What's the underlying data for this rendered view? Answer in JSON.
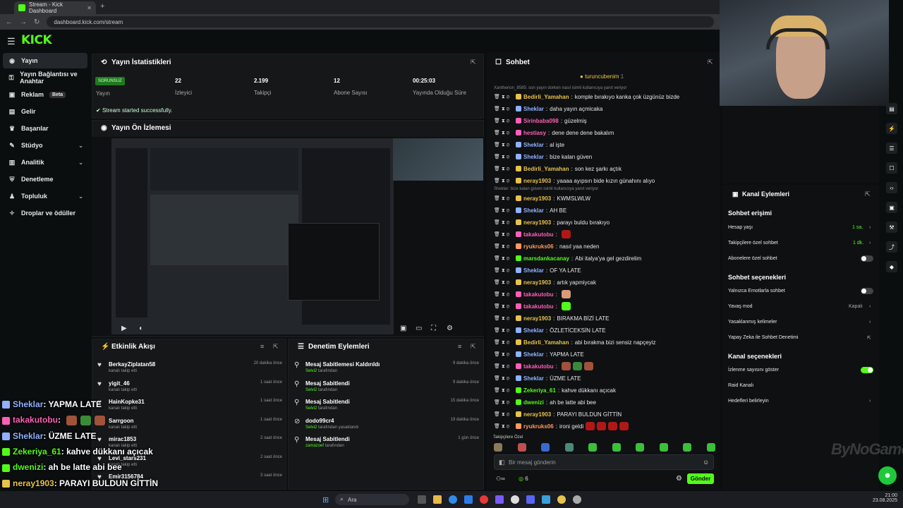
{
  "browser": {
    "tab_title": "Stream - Kick Dashboard",
    "url": "dashboard.kick.com/stream"
  },
  "brand": {
    "logo": "KICK",
    "accent": "#53fc18"
  },
  "sidebar": {
    "items": [
      {
        "label": "Yayın",
        "icon": "broadcast-icon"
      },
      {
        "label": "Yayın Bağlantısı ve Anahtar",
        "icon": "key-icon"
      },
      {
        "label": "Reklam",
        "icon": "ad-icon",
        "badge": "Beta"
      },
      {
        "label": "Gelir",
        "icon": "wallet-icon"
      },
      {
        "label": "Başarılar",
        "icon": "trophy-icon"
      },
      {
        "label": "Stüdyo",
        "icon": "studio-icon"
      },
      {
        "label": "Analitik",
        "icon": "chart-icon"
      },
      {
        "label": "Denetleme",
        "icon": "shield-icon"
      },
      {
        "label": "Topluluk",
        "icon": "people-icon"
      },
      {
        "label": "Droplar ve ödüller",
        "icon": "gift-icon"
      }
    ]
  },
  "stats": {
    "title": "Yayın İstatistikleri",
    "status_badge": "SORUNSUZ",
    "items": [
      {
        "value": "",
        "label": "Yayın"
      },
      {
        "value": "22",
        "label": "İzleyici"
      },
      {
        "value": "2.199",
        "label": "Takipçi"
      },
      {
        "value": "12",
        "label": "Abone Sayısı"
      },
      {
        "value": "00:25:03",
        "label": "Yayında Olduğu Süre"
      }
    ],
    "success_msg": "Stream started successfully."
  },
  "preview": {
    "title": "Yayın Ön İzlemesi"
  },
  "activity": {
    "title": "Etkinlik Akışı",
    "rows": [
      {
        "name": "BerkayZiplatan58",
        "sub": "kanalı takip etti",
        "time": "20 dakika önce"
      },
      {
        "name": "yigit_46",
        "sub": "kanalı takip etti",
        "time": "1 saat önce"
      },
      {
        "name": "HainKopke31",
        "sub": "kanalı takip etti",
        "time": "1 saat önce"
      },
      {
        "name": "Sarrgoon",
        "sub": "kanalı takip etti",
        "time": "1 saat önce"
      },
      {
        "name": "mirac1853",
        "sub": "kanalı takip etti",
        "time": "2 saat önce"
      },
      {
        "name": "Levi_stars231",
        "sub": "kanalı takip etti",
        "time": "2 saat önce"
      },
      {
        "name": "Emir3156784",
        "sub": "",
        "time": "3 saat önce"
      }
    ]
  },
  "moderation": {
    "title": "Denetim Eylemleri",
    "rows": [
      {
        "name": "Mesaj Sabitlemesi Kaldırıldı",
        "who": "Selvi2",
        "rest": " tarafından",
        "time": "9 dakika önce"
      },
      {
        "name": "Mesaj Sabitlendi",
        "who": "Selvi2",
        "rest": " tarafından",
        "time": "9 dakika önce"
      },
      {
        "name": "Mesaj Sabitlendi",
        "who": "Selvi2",
        "rest": " tarafından",
        "time": "15 dakika önce"
      },
      {
        "name": "dodo99cr4",
        "who": "Selvi2",
        "rest": " tarafından yasaklandı",
        "time": "19 dakika önce"
      },
      {
        "name": "Mesaj Sabitlendi",
        "who": "zamazoef",
        "rest": " tarafından",
        "time": "1 gün önce"
      }
    ]
  },
  "chat": {
    "title": "Sohbet",
    "pinned": "turuncubenim",
    "pinned_count": "1",
    "reply1": "Xantherion_8585: son yayın dorken nasıl isimli kullanıcıya yanıt veriyor",
    "reply2": "Sheklar: bize kalan güven isimli kullanıcıya yanıt veriyor",
    "messages": [
      {
        "user": "Bedirli_Yamahan",
        "color": "#e8c24a",
        "text": "komple bırakıyo kanka çok üzgünüz bizde"
      },
      {
        "user": "Sheklar",
        "color": "#8fb1ff",
        "text": "daha yayın açmicaka"
      },
      {
        "user": "Sirinbaba098",
        "color": "#ff5fb8",
        "text": "güzelmiş"
      },
      {
        "user": "hestiasy",
        "color": "#ff5fb8",
        "text": "dene dene dene bakalım"
      },
      {
        "user": "Sheklar",
        "color": "#8fb1ff",
        "text": "al işte"
      },
      {
        "user": "Sheklar",
        "color": "#8fb1ff",
        "text": "bize kalan güven"
      },
      {
        "user": "Bedirli_Yamahan",
        "color": "#e8c24a",
        "text": "son kez şarkı açtık"
      },
      {
        "user": "neray1903",
        "color": "#e8c24a",
        "text": "yaaaa ayıpsın bide kızın günahını alıyo"
      },
      {
        "user": "neray1903",
        "color": "#e8c24a",
        "text": "KWMSLWLW"
      },
      {
        "user": "Sheklar",
        "color": "#8fb1ff",
        "text": "AH BE"
      },
      {
        "user": "neray1903",
        "color": "#e8c24a",
        "text": "parayı buldu bırakıyo"
      },
      {
        "user": "takakutobu",
        "color": "#ff5fb8",
        "text": ""
      },
      {
        "user": "ryukruks06",
        "color": "#ff9a5f",
        "text": "nasıl yaa neden"
      },
      {
        "user": "marsdankacanay",
        "color": "#53fc18",
        "text": "Abi italya'ya gel gezdirelim"
      },
      {
        "user": "Sheklar",
        "color": "#8fb1ff",
        "text": "OF YA LATE"
      },
      {
        "user": "neray1903",
        "color": "#e8c24a",
        "text": "artık yapmiycak"
      },
      {
        "user": "takakutobu",
        "color": "#ff5fb8",
        "text": ""
      },
      {
        "user": "takakutobu",
        "color": "#ff5fb8",
        "text": ""
      },
      {
        "user": "neray1903",
        "color": "#e8c24a",
        "text": "BIRAKMA BİZİ LATE"
      },
      {
        "user": "Sheklar",
        "color": "#8fb1ff",
        "text": "ÖZLETİCEKSİN LATE"
      },
      {
        "user": "Bedirli_Yamahan",
        "color": "#e8c24a",
        "text": "abi bırakma bizi sensiz napçeyiz"
      },
      {
        "user": "Sheklar",
        "color": "#8fb1ff",
        "text": "YAPMA LATE"
      },
      {
        "user": "takakutobu",
        "color": "#ff5fb8",
        "text": ""
      },
      {
        "user": "Sheklar",
        "color": "#8fb1ff",
        "text": "ÜZME LATE"
      },
      {
        "user": "Zekeriya_61",
        "color": "#53fc18",
        "text": "kahve dükkanı açıcak"
      },
      {
        "user": "dwenizi",
        "color": "#53fc18",
        "text": "ah be latte abi bee"
      },
      {
        "user": "neray1903",
        "color": "#e8c24a",
        "text": "PARAYI BULDUN GİTTİN"
      },
      {
        "user": "ryukruks06",
        "color": "#ff9a5f",
        "text": "ironi geldi"
      }
    ],
    "followers_label": "Takipçilere Özel",
    "input_placeholder": "Bir mesaj gönderin",
    "viewer_count": "6",
    "send_label": "Gönder"
  },
  "channel_actions": {
    "title": "Kanal Eylemleri",
    "chat_access": "Sohbet erişimi",
    "account_age": {
      "label": "Hesap yaşı",
      "value": "1 sa."
    },
    "followers_only": {
      "label": "Takipçilere özel sohbet",
      "value": "1 dk."
    },
    "subs_only": {
      "label": "Abonelere özel sohbet"
    },
    "chat_options": "Sohbet seçenekleri",
    "emote_only": {
      "label": "Yalnızca Emotlarla sohbet"
    },
    "slow_mode": {
      "label": "Yavaş mod",
      "value": "Kapalı"
    },
    "banned_words": {
      "label": "Yasaklanmış kelimeler"
    },
    "ai_mod": {
      "label": "Yapay Zeka ile Sohbet Denetimi"
    },
    "channel_options": "Kanal seçenekleri",
    "show_viewers": {
      "label": "İzlenme sayısını göster"
    },
    "raid": {
      "label": "Raid Kanalı"
    },
    "goals": {
      "label": "Hedefleri belirleyin"
    }
  },
  "overlay_chat": [
    {
      "user": "Sheklar",
      "color": "#8fb1ff",
      "text": ": YAPMA LATE"
    },
    {
      "user": "takakutobu",
      "color": "#ff5fb8",
      "text": ": "
    },
    {
      "user": "Sheklar",
      "color": "#8fb1ff",
      "text": ": ÜZME LATE"
    },
    {
      "user": "Zekeriya_61",
      "color": "#53fc18",
      "text": ": kahve dükkanı açıcak"
    },
    {
      "user": "dwenizi",
      "color": "#53fc18",
      "text": ": ah be latte abi bee"
    },
    {
      "user": "neray1903",
      "color": "#e8c24a",
      "text": ": PARAYI BULDUN GİTTİN"
    },
    {
      "user": "ryukruks06",
      "color": "#ff9a5f",
      "text": ": ironi geldi"
    }
  ],
  "taskbar": {
    "search": "Ara",
    "time": "21:00",
    "date": "23.08.2025"
  },
  "watermark": "ByNoGame"
}
